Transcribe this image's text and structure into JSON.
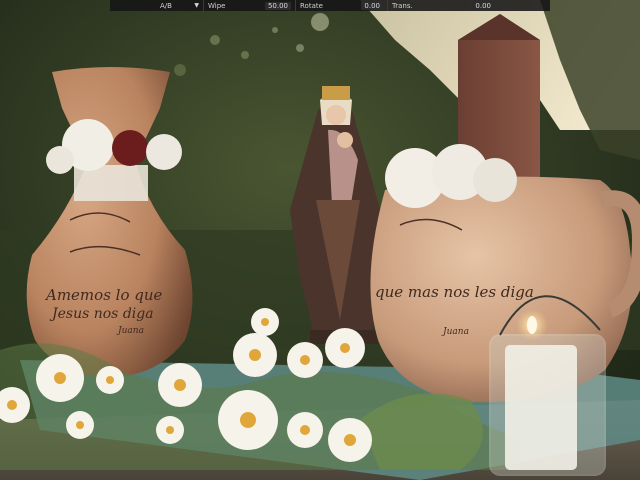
{
  "viewer": {
    "ab_selector": {
      "value": "A/B",
      "arrow_icon": "triangle-down-icon"
    },
    "wipe": {
      "label": "Wipe",
      "value": "50.00"
    },
    "rotate": {
      "label": "Rotate",
      "value": "0.00"
    },
    "trans": {
      "label": "Trans.",
      "value": "0.00"
    }
  },
  "image_text": {
    "left_vase_line1": "Amemos lo que",
    "left_vase_line2": "Jesus nos diga",
    "left_vase_sig": "Juana",
    "right_vase_line1": "que mas nos les diga",
    "right_vase_sig": "Juana"
  },
  "colors": {
    "bar_bg": "#161616",
    "foliage": "#2f3b22",
    "clay": "#b07a58",
    "sky": "#e8dcbf"
  }
}
